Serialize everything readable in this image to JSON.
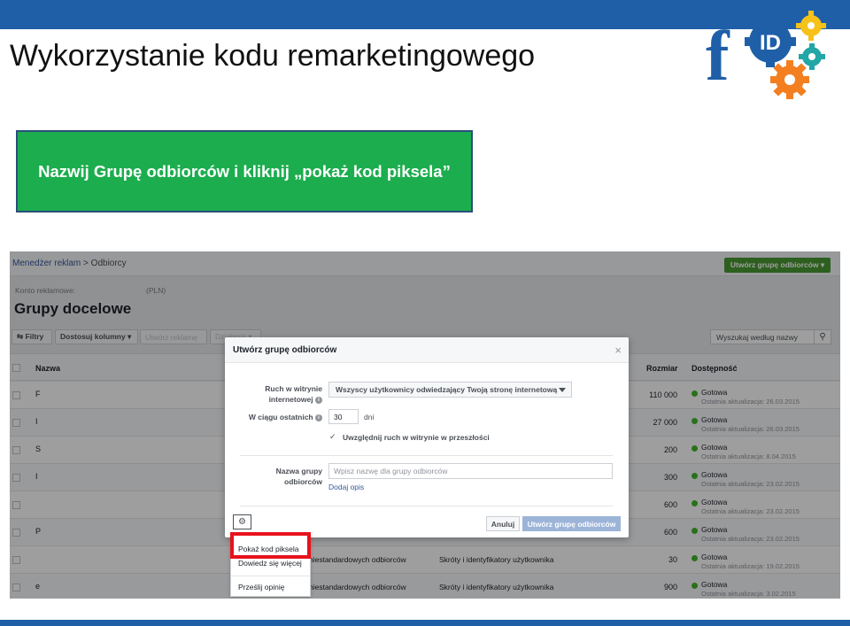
{
  "slide": {
    "title": "Wykorzystanie kodu remarketingowego",
    "instruction": "Nazwij Grupę odbiorców i kliknij „pokaż kod piksela”",
    "colors": {
      "top_bar": "#1f5fa8",
      "green_box": "#1cad4e",
      "highlight": "#e8121c"
    }
  },
  "logo": {
    "letter": "f",
    "badge": "ID"
  },
  "fb": {
    "breadcrumb": {
      "root": "Menedżer reklam",
      "separator": ">",
      "current": "Odbiorcy"
    },
    "create_button": "Utwórz grupę odbiorców ▾",
    "account_label": "Konto reklamowe:",
    "account_currency": "(PLN)",
    "page_title": "Grupy docelowe",
    "toolbar": {
      "filters": "⇆ Filtry",
      "columns": "Dostosuj kolumny ▾",
      "create_ad": "Utwórz reklamę",
      "actions": "Działania ▾",
      "search_placeholder": "Wyszukaj według nazwy"
    },
    "columns": {
      "name": "Nazwa",
      "size": "Rozmiar",
      "availability": "Dostępność"
    },
    "rows": [
      {
        "initial": "F",
        "size": "110 000",
        "status": "Gotowa",
        "updated": "Ostatnia aktualizacja: 26.03.2015",
        "type": "",
        "source": ""
      },
      {
        "initial": "I",
        "size": "27 000",
        "status": "Gotowa",
        "updated": "Ostatnia aktualizacja: 26.03.2015",
        "type": "",
        "source": ""
      },
      {
        "initial": "S",
        "size": "200",
        "status": "Gotowa",
        "updated": "Ostatnia aktualizacja: 8.04.2015",
        "type": "",
        "source": ""
      },
      {
        "initial": "I",
        "size": "300",
        "status": "Gotowa",
        "updated": "Ostatnia aktualizacja: 23.02.2015",
        "type": "",
        "source": ""
      },
      {
        "initial": "",
        "size": "600",
        "status": "Gotowa",
        "updated": "Ostatnia aktualizacja: 23.02.2015",
        "type": "",
        "source": ""
      },
      {
        "initial": "P",
        "size": "600",
        "status": "Gotowa",
        "updated": "Ostatnia aktualizacja: 23.02.2015",
        "type": "",
        "source": ""
      },
      {
        "initial": "",
        "size": "30",
        "status": "Gotowa",
        "updated": "Ostatnia aktualizacja: 19.02.2015",
        "type": "niestandardowych odbiorców",
        "source": "Skróty i identyfikatory użytkownika"
      },
      {
        "initial": "e",
        "size": "900",
        "status": "Gotowa",
        "updated": "Ostatnia aktualizacja: 3.02.2015",
        "type": "niestandardowych odbiorców",
        "source": "Skróty i identyfikatory użytkownika"
      }
    ],
    "modal": {
      "title": "Utwórz grupę odbiorców",
      "close": "×",
      "traffic_label": "Ruch w witrynie internetowej",
      "traffic_value": "Wszyscy użytkownicy odwiedzający Twoją stronę internetową",
      "days_label": "W ciągu ostatnich",
      "days_value": "30",
      "days_unit": "dni",
      "checkbox_label": "Uwzględnij ruch w witrynie w przeszłości",
      "checkbox_checked": true,
      "name_label": "Nazwa grupy odbiorców",
      "name_placeholder": "Wpisz nazwę dla grupy odbiorców",
      "add_description": "Dodaj opis",
      "cancel": "Anuluj",
      "submit": "Utwórz grupę odbiorców"
    },
    "menu": {
      "show_pixel": "Pokaż kod piksela",
      "learn_more": "Dowiedz się więcej",
      "feedback": "Prześlij opinię"
    }
  }
}
